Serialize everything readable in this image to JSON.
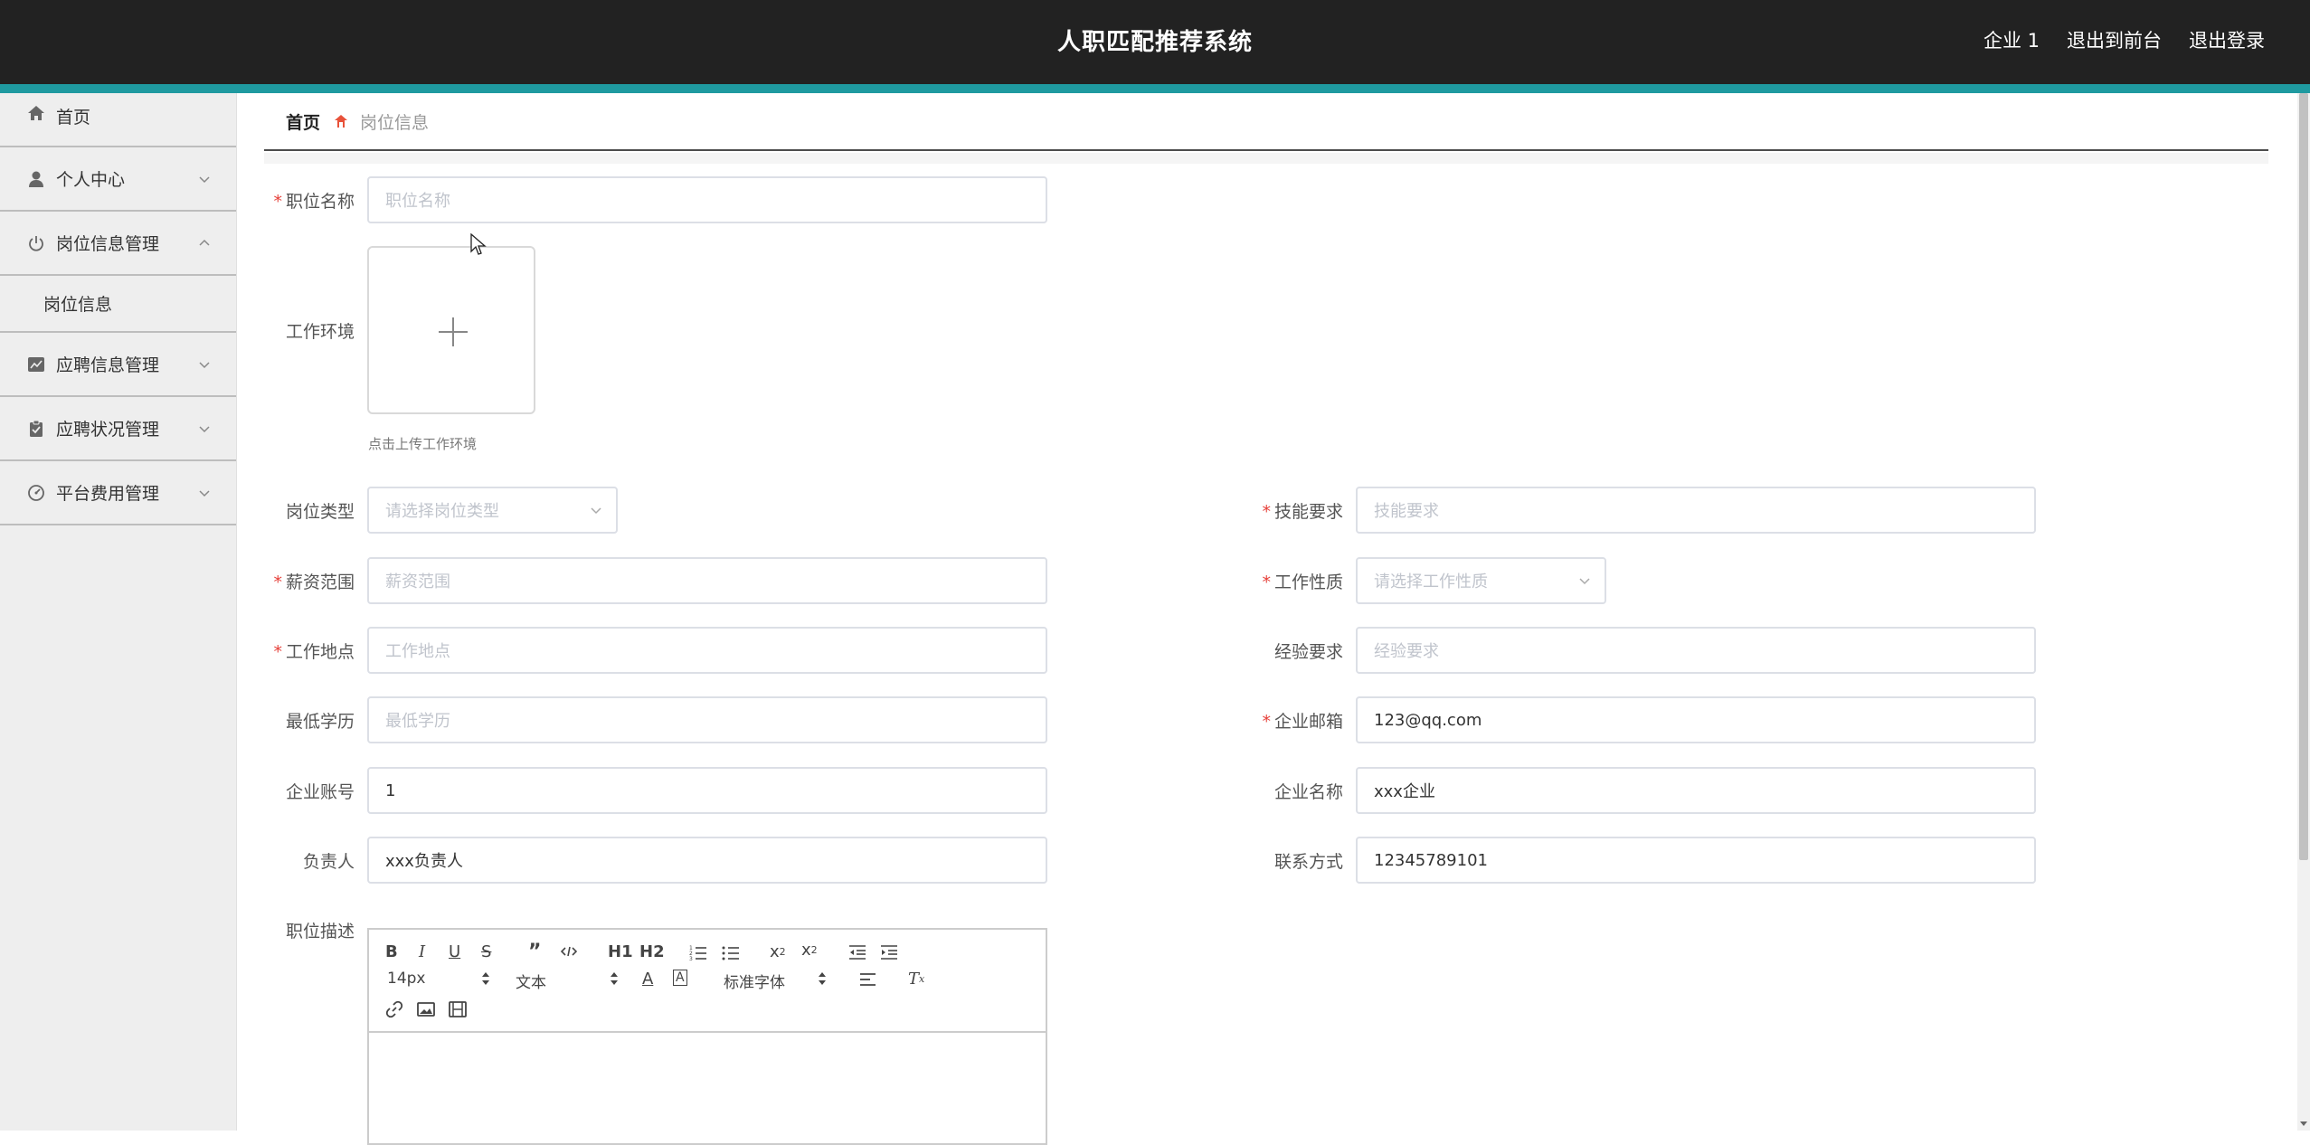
{
  "header": {
    "title": "人职匹配推荐系统",
    "links": [
      "企业 1",
      "退出到前台",
      "退出登录"
    ]
  },
  "sidebar": {
    "items": [
      {
        "label": "首页",
        "icon": "home-icon"
      },
      {
        "label": "个人中心",
        "icon": "user-icon"
      },
      {
        "label": "岗位信息管理",
        "icon": "power-icon"
      },
      {
        "label": "应聘信息管理",
        "icon": "chart-icon"
      },
      {
        "label": "应聘状况管理",
        "icon": "clipboard-icon"
      },
      {
        "label": "平台费用管理",
        "icon": "gauge-icon"
      }
    ],
    "submenu": {
      "label": "岗位信息"
    }
  },
  "breadcrumb": {
    "home": "首页",
    "current": "岗位信息"
  },
  "form": {
    "job_name": {
      "label": "职位名称",
      "placeholder": "职位名称"
    },
    "work_env": {
      "label": "工作环境",
      "tip": "点击上传工作环境"
    },
    "job_type": {
      "label": "岗位类型",
      "placeholder": "请选择岗位类型"
    },
    "skill": {
      "label": "技能要求",
      "placeholder": "技能要求"
    },
    "salary": {
      "label": "薪资范围",
      "placeholder": "薪资范围"
    },
    "work_nature": {
      "label": "工作性质",
      "placeholder": "请选择工作性质"
    },
    "location": {
      "label": "工作地点",
      "placeholder": "工作地点"
    },
    "experience": {
      "label": "经验要求",
      "placeholder": "经验要求"
    },
    "education": {
      "label": "最低学历",
      "placeholder": "最低学历"
    },
    "email": {
      "label": "企业邮箱",
      "value": "123@qq.com"
    },
    "account": {
      "label": "企业账号",
      "value": "1"
    },
    "company": {
      "label": "企业名称",
      "value": "xxx企业"
    },
    "manager": {
      "label": "负责人",
      "value": "xxx负责人"
    },
    "contact": {
      "label": "联系方式",
      "value": "12345789101"
    },
    "description": {
      "label": "职位描述"
    }
  },
  "editor": {
    "size": "14px",
    "header": "文本",
    "font": "标准字体",
    "h1": "H1",
    "h2": "H2"
  },
  "colors": {
    "header_bg": "#222222",
    "accent": "#1f9aa0",
    "required": "#e6403a",
    "sidebar_bg": "#eeeeee"
  }
}
